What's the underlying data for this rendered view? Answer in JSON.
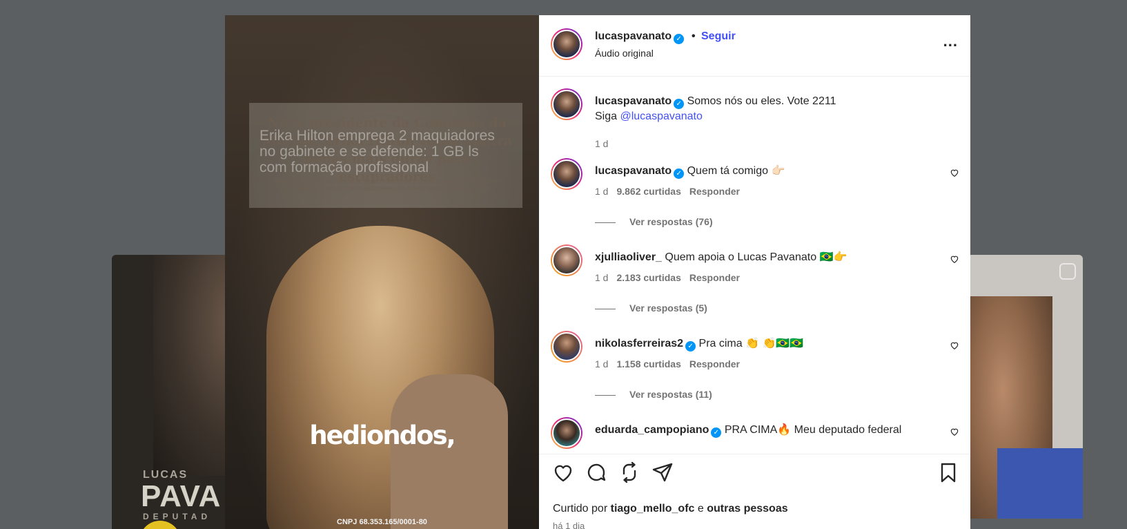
{
  "background": {
    "left_card": {
      "small": "LUCAS",
      "big": "PAVA",
      "sub": "DEPUTAD"
    }
  },
  "media": {
    "news_headline": "Nova presidente da Comissão da Mulher, Erika Hilton votou contra penas mais duras para estupradores",
    "news_sub": "Deputada do PSOL foi escolhida nesta semana para presidir colegiado na Câmara; posicionamento sobre crimes hediondos cria debate sobre coerência política",
    "overlay_text": "Erika Hilton emprega 2 maquiadores no gabinete e se defende: 1 GB ls com formação profissional",
    "caption_word": "hediondos,",
    "cnpj": "CNPJ 68.353.165/0001-80"
  },
  "header": {
    "username": "lucaspavanato",
    "follow_label": "Seguir",
    "separator": "•",
    "audio": "Áudio original",
    "more": "..."
  },
  "caption": {
    "username": "lucaspavanato",
    "text_line1": "Somos nós ou eles. Vote 2211",
    "text_prefix": "Siga ",
    "mention": "@lucaspavanato",
    "time": "1 d"
  },
  "comments": [
    {
      "username": "lucaspavanato",
      "verified": true,
      "text": "Quem tá comigo 👉🏻",
      "time": "1 d",
      "likes": "9.862 curtidas",
      "reply": "Responder",
      "replies": "Ver respostas (76)"
    },
    {
      "username": "xjulliaoliver_",
      "verified": false,
      "text": "Quem apoia o Lucas Pavanato 🇧🇷👉",
      "time": "1 d",
      "likes": "2.183 curtidas",
      "reply": "Responder",
      "replies": "Ver respostas (5)"
    },
    {
      "username": "nikolasferreiras2",
      "verified": true,
      "text": "Pra cima 👏 👏🇧🇷🇧🇷",
      "time": "1 d",
      "likes": "1.158 curtidas",
      "reply": "Responder",
      "replies": "Ver respostas (11)"
    },
    {
      "username": "eduarda_campopiano",
      "verified": true,
      "text": "PRA CIMA🔥 Meu deputado federal"
    }
  ],
  "footer": {
    "liked_by_prefix": "Curtido por",
    "liked_by_user": "tiago_mello_ofc",
    "liked_by_and": "e",
    "liked_by_others": "outras pessoas",
    "time_ago": "há 1 dia"
  },
  "icons": [
    "heart-icon",
    "comment-icon",
    "repost-icon",
    "share-icon",
    "save-icon",
    "verified-icon",
    "more-icon"
  ]
}
